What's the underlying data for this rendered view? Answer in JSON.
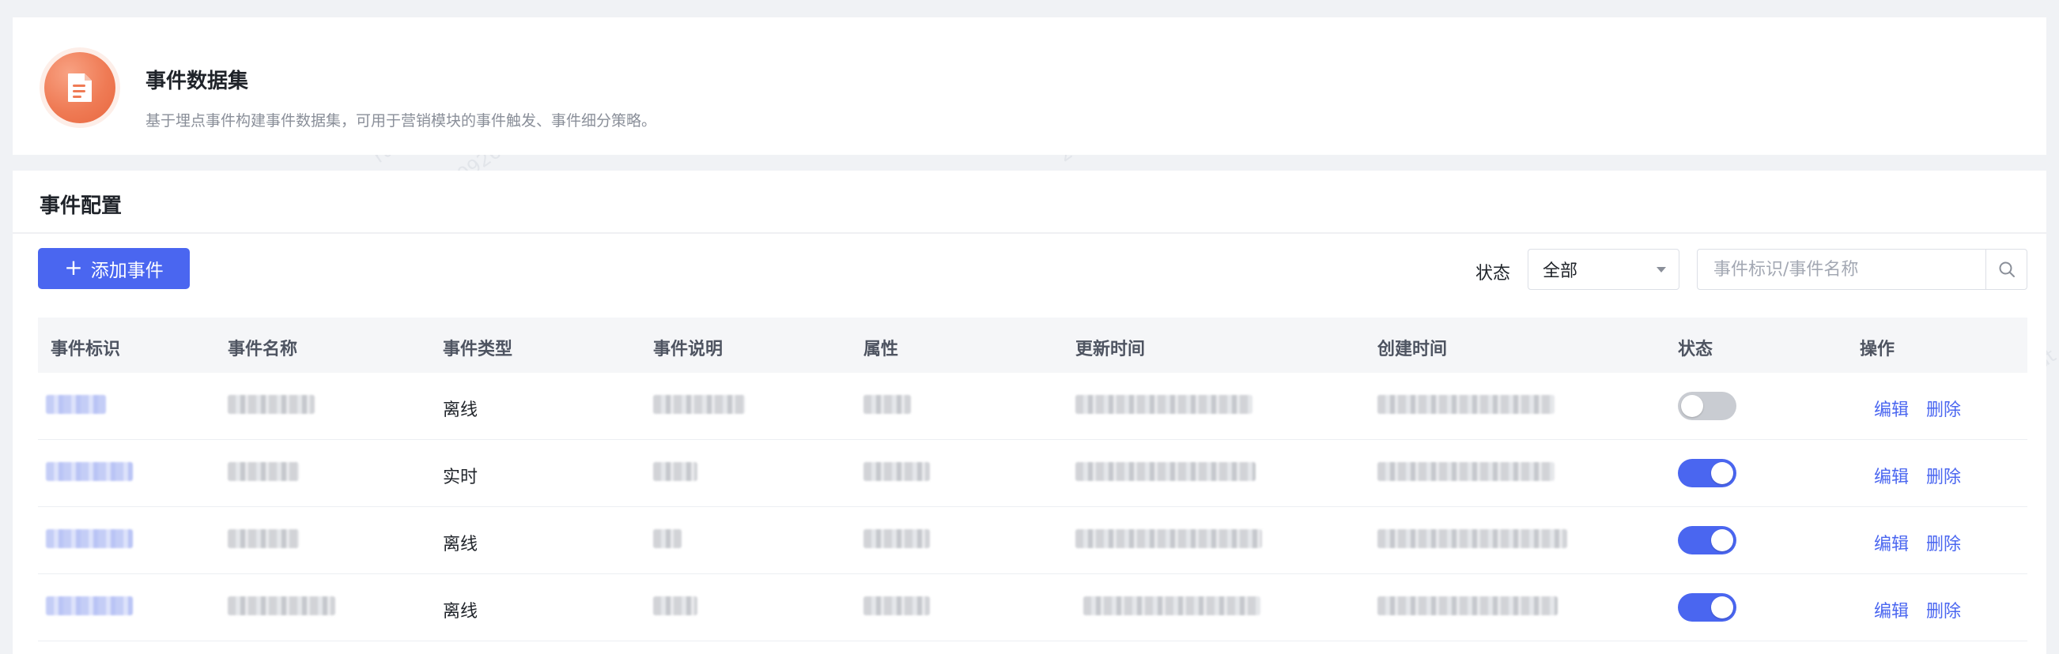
{
  "intro": {
    "title": "事件数据集",
    "description": "基于埋点事件构建事件数据集，可用于营销模块的事件触发、事件细分策略。",
    "icon": "document-icon",
    "accent": "#ef7b55"
  },
  "config": {
    "title": "事件配置",
    "add_button": "添加事件",
    "status_label": "状态",
    "status_value": "全部",
    "search_placeholder": "事件标识/事件名称"
  },
  "table": {
    "headers": [
      "事件标识",
      "事件名称",
      "事件类型",
      "事件说明",
      "属性",
      "更新时间",
      "创建时间",
      "状态",
      "操作"
    ],
    "rows": [
      {
        "type": "离线",
        "enabled": false,
        "edit": "编辑",
        "delete": "删除"
      },
      {
        "type": "实时",
        "enabled": true,
        "edit": "编辑",
        "delete": "删除"
      },
      {
        "type": "离线",
        "enabled": true,
        "edit": "编辑",
        "delete": "删除"
      },
      {
        "type": "离线",
        "enabled": true,
        "edit": "编辑",
        "delete": "删除"
      }
    ]
  },
  "colors": {
    "primary": "#4a66f0",
    "toggle_off": "#c9ccd2",
    "header_bg": "#f5f6f8"
  }
}
